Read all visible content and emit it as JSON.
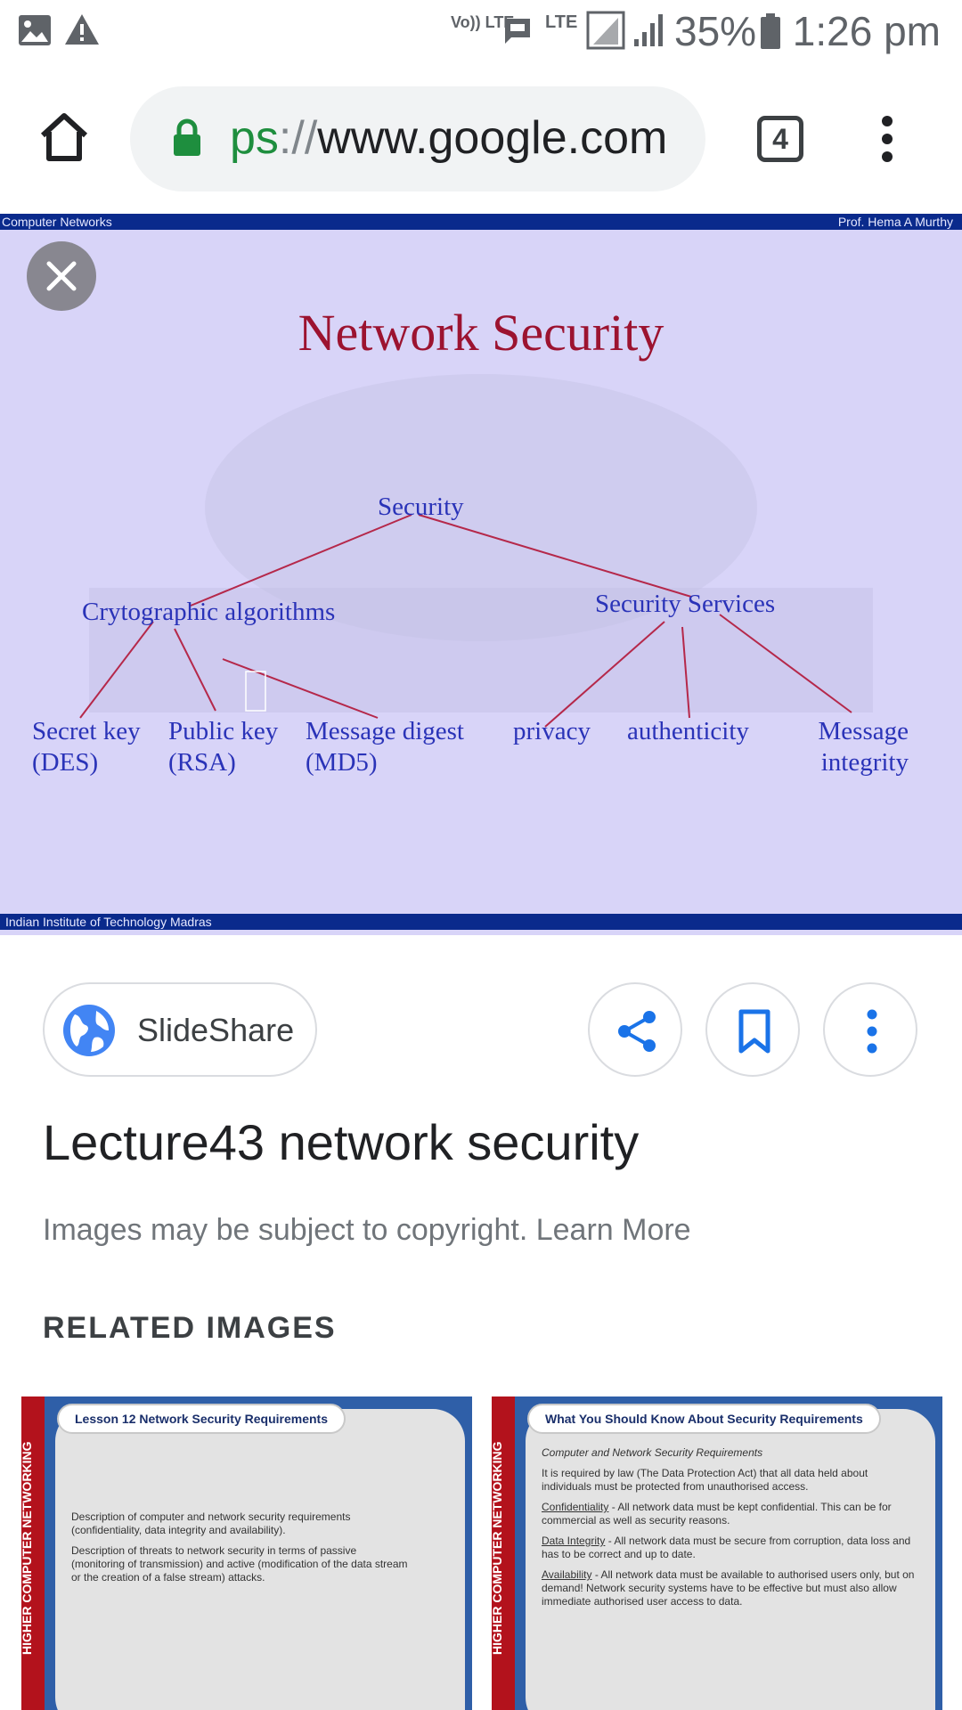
{
  "status_bar": {
    "left_icons": [
      "image-icon",
      "warning-icon"
    ],
    "volte_label": "Vo)) LTE",
    "lte_label": "LTE",
    "battery_percent": "35%",
    "time": "1:26 pm"
  },
  "browser": {
    "url_scheme": "ps",
    "url_separator": "://",
    "url_host": "www.google.com",
    "tab_count": "4"
  },
  "slide": {
    "header_left": "Computer Networks",
    "header_right": "Prof. Hema A Murthy",
    "title": "Network Security",
    "root": "Security",
    "branch_left": "Crytographic algorithms",
    "branch_right": "Security Services",
    "leaves": {
      "secret_key_1": "Secret key",
      "secret_key_2": "(DES)",
      "public_key_1": "Public key",
      "public_key_2": "(RSA)",
      "message_digest_1": "Message digest",
      "message_digest_2": "(MD5)",
      "privacy": "privacy",
      "authenticity": "authenticity",
      "message_integrity_1": "Message",
      "message_integrity_2": "integrity"
    },
    "footer": "Indian Institute of Technology Madras"
  },
  "source": {
    "site_name": "SlideShare"
  },
  "page_title": "Lecture43 network security",
  "copyright_text": "Images may be subject to copyright. Learn More",
  "related_heading": "RELATED IMAGES",
  "related": [
    {
      "side_label": "HIGHER COMPUTER NETWORKING",
      "heading": "Lesson 12 Network Security Requirements",
      "paragraphs": [
        "Description of computer and network security requirements (confidentiality, data integrity and availability).",
        "Description of threats to network security in terms of passive (monitoring of transmission) and active (modification of the data stream or the creation of a false stream) attacks."
      ]
    },
    {
      "side_label": "HIGHER COMPUTER NETWORKING",
      "heading": "What You Should Know About Security Requirements",
      "subheading": "Computer and Network Security Requirements",
      "intro": "It is required by law (The Data Protection Act) that all data held about individuals must be protected from unauthorised access.",
      "items": [
        {
          "term": "Confidentiality",
          "text": " - All network data must be kept confidential. This can be for commercial as well as security reasons."
        },
        {
          "term": "Data Integrity",
          "text": " - All network data must be secure from corruption, data loss and has to be correct and up to date."
        },
        {
          "term": "Availability",
          "text": " - All network data must be available to authorised users only, but on demand! Network security systems have to be effective but must also allow immediate authorised user access to data."
        }
      ]
    }
  ]
}
